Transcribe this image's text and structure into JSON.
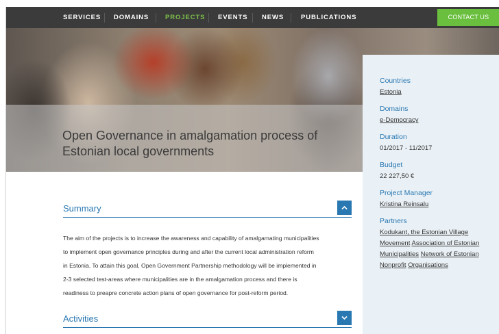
{
  "nav": {
    "items": [
      {
        "label": "SERVICES"
      },
      {
        "label": "DOMAINS"
      },
      {
        "label": "PROJECTS"
      },
      {
        "label": "EVENTS"
      },
      {
        "label": "NEWS"
      },
      {
        "label": "PUBLICATIONS"
      }
    ],
    "active_color": "#7cc04b",
    "contact_label": "CONTACT US",
    "contact_color": "#6abf3f"
  },
  "hero": {
    "title_line1": "Open Governance in amalgamation process of",
    "title_line2": "Estonian local governments"
  },
  "sidebar": {
    "countries_label": "Countries",
    "countries_value": "Estonia",
    "domains_label": "Domains",
    "domains_value": "e-Democracy",
    "duration_label": "Duration",
    "duration_value": "01/2017 - 11/2017",
    "budget_label": "Budget",
    "budget_value": "22 227,50 €",
    "manager_label": "Project Manager",
    "manager_value": "Kristina Reinsalu",
    "partners_label": "Partners",
    "partners": [
      {
        "line1": "Kodukant, the Estonian Village",
        "line2": "Movement"
      },
      {
        "line1": "Association of Estonian",
        "line2": "Municipalities"
      },
      {
        "line1": "Network of Estonian Nonprofit",
        "line2": "Organisations"
      }
    ]
  },
  "summary": {
    "title": "Summary",
    "lines": [
      "The aim of the projects is to increase the awareness and capability of amalgamating municipalities",
      "to implement open governance principles during and after the current local administration reform",
      "in Estonia. To attain this goal, Open Government Partnership methodology will be implemented in",
      "2-3 selected test-areas where municipalities are in the amalgamation process and there is",
      "readiness to preapre concrete action plans of open governance for post-reform period."
    ]
  },
  "activities": {
    "title": "Activities"
  },
  "colors": {
    "accent": "#2a78b2",
    "nav_bg": "#3b3b3b",
    "sidebar_bg": "#eaf1f6"
  },
  "icons": {
    "summary_toggle": "chevron-up-icon",
    "activities_toggle": "chevron-down-icon"
  }
}
